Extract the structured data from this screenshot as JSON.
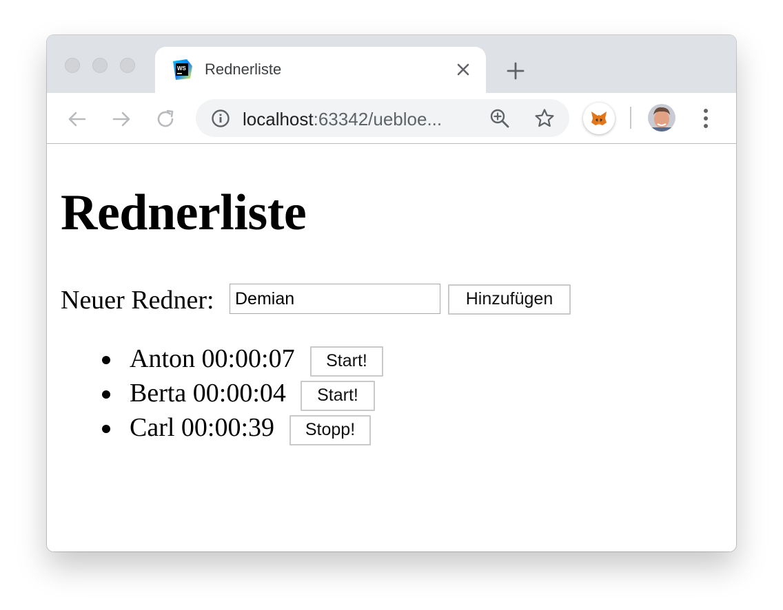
{
  "browser": {
    "tab": {
      "title": "Rednerliste",
      "favicon_text": "WS",
      "favicon_icon": "webstorm-icon",
      "close_icon": "close-icon"
    },
    "new_tab_icon": "plus-icon",
    "toolbar": {
      "back_icon": "back-arrow-icon",
      "forward_icon": "forward-arrow-icon",
      "reload_icon": "reload-icon",
      "info_icon": "info-icon",
      "url_host": "localhost",
      "url_rest": ":63342/uebloe...",
      "zoom_icon": "zoom-in-icon",
      "bookmark_icon": "star-icon",
      "extension_icon": "metamask-fox-icon",
      "profile_icon": "avatar",
      "menu_icon": "kebab-menu-icon"
    }
  },
  "page": {
    "heading": "Rednerliste",
    "new_speaker_label": "Neuer Redner:",
    "name_input_value": "Demian",
    "add_button_label": "Hinzufügen",
    "speakers": [
      {
        "text": "Anton 00:00:07",
        "button_label": "Start!"
      },
      {
        "text": "Berta 00:00:04",
        "button_label": "Start!"
      },
      {
        "text": "Carl 00:00:39",
        "button_label": "Stopp!"
      }
    ]
  },
  "colors": {
    "tabstrip": "#dee1e6",
    "omnibox": "#f1f3f4",
    "icon_gray": "#5f6368"
  }
}
